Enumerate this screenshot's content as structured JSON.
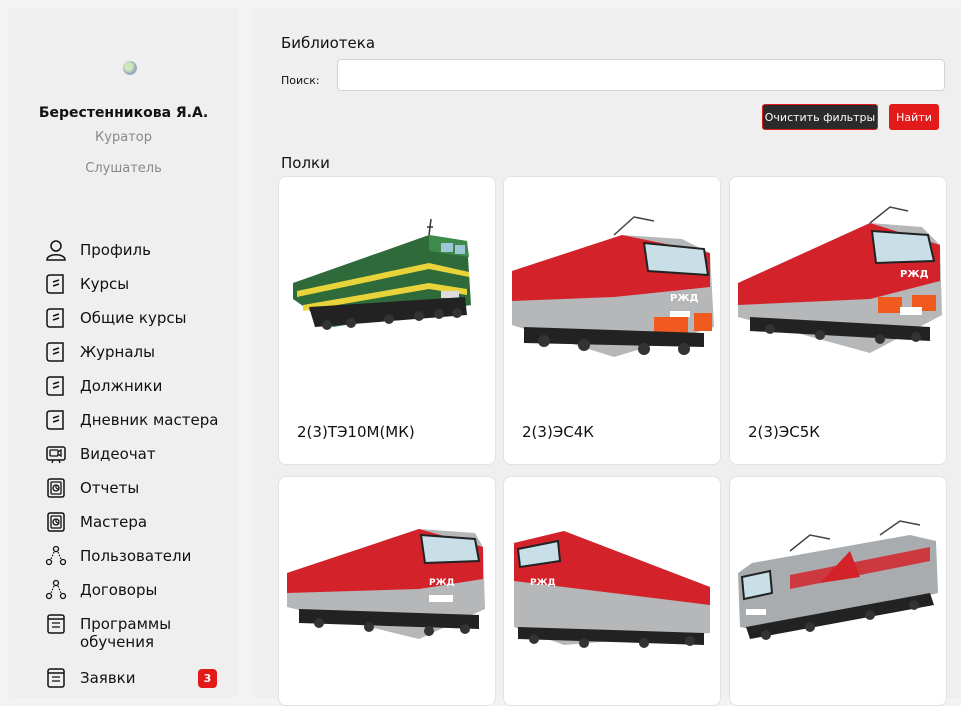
{
  "sidebar": {
    "user_name": "Берестенникова Я.А.",
    "roles": [
      "Куратор",
      "Слушатель"
    ],
    "menu": [
      {
        "label": "Профиль",
        "icon": "profile-icon"
      },
      {
        "label": "Курсы",
        "icon": "book-icon"
      },
      {
        "label": "Общие курсы",
        "icon": "book-icon"
      },
      {
        "label": "Журналы",
        "icon": "book-icon"
      },
      {
        "label": "Должники",
        "icon": "book-icon"
      },
      {
        "label": "Дневник мастера",
        "icon": "book-icon"
      },
      {
        "label": "Видеочат",
        "icon": "video-chat-icon"
      },
      {
        "label": "Отчеты",
        "icon": "report-icon"
      },
      {
        "label": "Мастера",
        "icon": "report-icon"
      },
      {
        "label": "Пользователи",
        "icon": "users-icon"
      },
      {
        "label": "Договоры",
        "icon": "users-icon"
      },
      {
        "label": "Программы обучения",
        "icon": "list-icon"
      },
      {
        "label": "Заявки",
        "icon": "list-icon",
        "badge": "3"
      }
    ]
  },
  "main": {
    "title": "Библиотека",
    "search": {
      "label": "Поиск:",
      "value": "",
      "placeholder": ""
    },
    "clear_button": "Очистить фильтры",
    "find_button": "Найти",
    "shelves_title": "Полки",
    "shelves": [
      {
        "title": "2(3)ТЭ10М(МК)",
        "image": "green-diesel-locomotive"
      },
      {
        "title": "2(3)ЭС4К",
        "image": "red-electric-locomotive"
      },
      {
        "title": "2(3)ЭС5К",
        "image": "red-electric-locomotive"
      },
      {
        "title": "",
        "image": "red-diesel-locomotive"
      },
      {
        "title": "",
        "image": "red-diesel-locomotive"
      },
      {
        "title": "",
        "image": "grey-electric-locomotive"
      }
    ]
  },
  "colors": {
    "accent": "#e21a1a",
    "dark_button": "#2b2b2b",
    "panel": "#efefef",
    "rzd_green": "#2f6b3a",
    "rzd_grey": "#a9acae"
  }
}
